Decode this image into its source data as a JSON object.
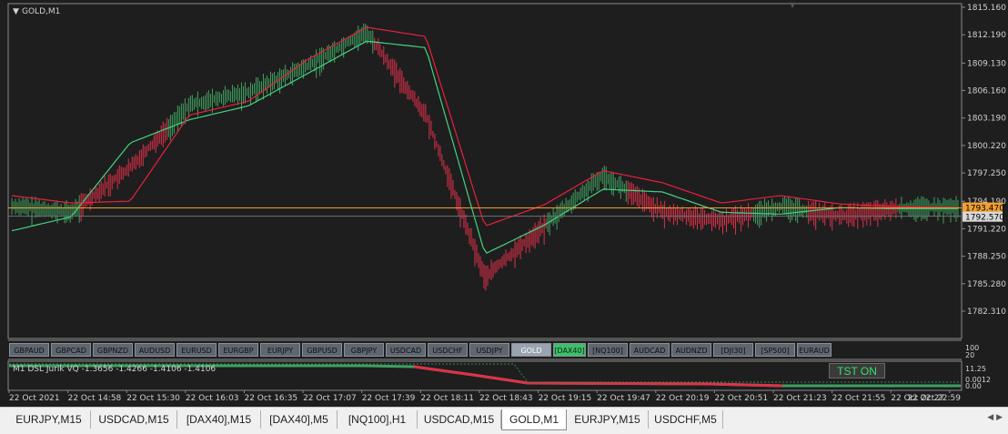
{
  "window": {
    "title": "GOLD,M1"
  },
  "price_axis": {
    "labels": [
      "1815.160",
      "1812.190",
      "1809.130",
      "1806.160",
      "1803.190",
      "1800.220",
      "1797.250",
      "1794.190",
      "1791.220",
      "1788.250",
      "1785.280",
      "1782.310"
    ],
    "bid_label": "1793.470",
    "ref_label": "1792.570",
    "bid_color": "#f0a030"
  },
  "time_axis": {
    "labels": [
      "22 Oct 2021",
      "22 Oct 14:58",
      "22 Oct 15:30",
      "22 Oct 16:03",
      "22 Oct 16:35",
      "22 Oct 17:07",
      "22 Oct 17:39",
      "22 Oct 18:11",
      "22 Oct 18:43",
      "22 Oct 19:15",
      "22 Oct 19:47",
      "22 Oct 20:19",
      "22 Oct 20:51",
      "22 Oct 21:23",
      "22 Oct 21:55",
      "22 Oct 22:27",
      "22 Oct 22:59"
    ]
  },
  "symbol_buttons": [
    {
      "label": "GBPAUD"
    },
    {
      "label": "GBPCAD"
    },
    {
      "label": "GBPNZD"
    },
    {
      "label": "AUDUSD"
    },
    {
      "label": "EURUSD"
    },
    {
      "label": "EURGBP"
    },
    {
      "label": "EURJPY"
    },
    {
      "label": "GBPUSD"
    },
    {
      "label": "GBPJPY"
    },
    {
      "label": "USDCAD"
    },
    {
      "label": "USDCHF"
    },
    {
      "label": "USDJPY"
    },
    {
      "label": "GOLD",
      "state": "active"
    },
    {
      "label": "[DAX40]",
      "state": "green"
    },
    {
      "label": "[NQ100]"
    },
    {
      "label": "AUDCAD"
    },
    {
      "label": "AUDNZD"
    },
    {
      "label": "[DJI30]"
    },
    {
      "label": "[SP500]"
    },
    {
      "label": "EURAUD"
    }
  ],
  "indicator": {
    "title": "M1 DSL Jurik VQ -1.3656 -1.4266 -1.4106 -1.4106",
    "tst_label": "TST ON",
    "axis_labels": [
      "100",
      "20",
      "11.25",
      "0.0012",
      "0.00"
    ]
  },
  "tabs": [
    {
      "label": "EURJPY,M15"
    },
    {
      "label": "USDCAD,M15"
    },
    {
      "label": "[DAX40],M15"
    },
    {
      "label": "[DAX40],M5"
    },
    {
      "label": "[NQ100],H1"
    },
    {
      "label": "USDCAD,M15"
    },
    {
      "label": "GOLD,M1",
      "active": true
    },
    {
      "label": "EURJPY,M15"
    },
    {
      "label": "USDCHF,M5"
    }
  ],
  "colors": {
    "bull": "#3fa060",
    "bear": "#e0304a",
    "bid_line": "#f0a030",
    "green_line": "#44d480",
    "red_line": "#e8203c"
  },
  "chart_data": {
    "type": "line",
    "symbol": "GOLD",
    "timeframe": "M1",
    "ylim": [
      1782.31,
      1815.16
    ],
    "x": [
      "22 Oct 2021",
      "22 Oct 14:58",
      "22 Oct 15:30",
      "22 Oct 16:03",
      "22 Oct 16:35",
      "22 Oct 17:07",
      "22 Oct 17:39",
      "22 Oct 18:11",
      "22 Oct 18:43",
      "22 Oct 19:15",
      "22 Oct 19:47",
      "22 Oct 20:19",
      "22 Oct 20:51",
      "22 Oct 21:23",
      "22 Oct 21:55",
      "22 Oct 22:27",
      "22 Oct 22:59"
    ],
    "series": [
      {
        "values": [
          1793.7,
          1793.0,
          1797.8,
          1804.6,
          1806.0,
          1808.8,
          1812.5,
          1803.5,
          1786.0,
          1791.5,
          1797.0,
          1793.0,
          1792.1,
          1793.6,
          1792.6,
          1793.4,
          1793.5
        ]
      },
      {
        "values": [
          1791.0,
          1792.5,
          1800.5,
          1803.0,
          1804.5,
          1808.0,
          1811.5,
          1810.8,
          1788.5,
          1791.6,
          1795.5,
          1795.2,
          1793.0,
          1792.8,
          1793.5,
          1793.4,
          1793.4
        ]
      },
      {
        "values": [
          1794.8,
          1794.0,
          1794.2,
          1803.5,
          1805.0,
          1809.5,
          1813.0,
          1812.0,
          1791.5,
          1793.8,
          1797.5,
          1796.2,
          1794.0,
          1794.8,
          1793.9,
          1793.6,
          1793.5
        ]
      }
    ]
  }
}
